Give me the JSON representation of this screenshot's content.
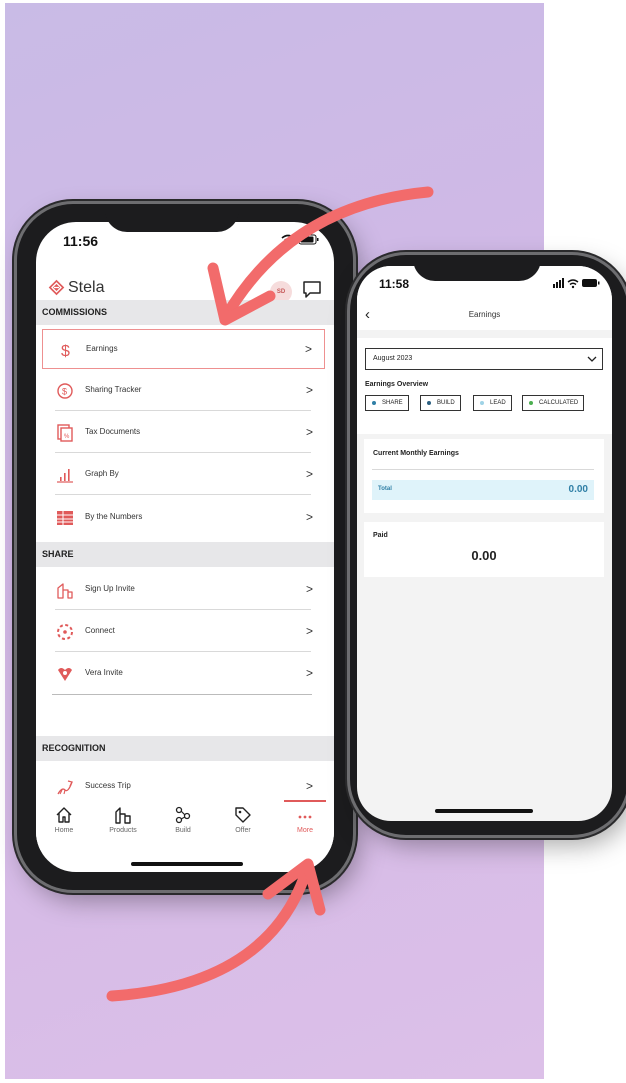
{
  "phone1": {
    "status_time": "11:56",
    "app_name": "Stela",
    "avatar_initials": "SD",
    "sections": {
      "commissions": {
        "title": "COMMISSIONS",
        "items": [
          {
            "label": "Earnings",
            "icon": "dollar-icon",
            "selected": true
          },
          {
            "label": "Sharing Tracker",
            "icon": "sharing-tracker-icon"
          },
          {
            "label": "Tax Documents",
            "icon": "tax-document-icon"
          },
          {
            "label": "Graph By",
            "icon": "bar-graph-icon"
          },
          {
            "label": "By the Numbers",
            "icon": "table-icon"
          }
        ]
      },
      "share": {
        "title": "SHARE",
        "items": [
          {
            "label": "Sign Up Invite",
            "icon": "sign-up-invite-icon"
          },
          {
            "label": "Connect",
            "icon": "connect-icon"
          },
          {
            "label": "Vera Invite",
            "icon": "vera-invite-icon"
          }
        ]
      },
      "recognition": {
        "title": "RECOGNITION",
        "items": [
          {
            "label": "Success Trip",
            "icon": "success-trip-icon"
          }
        ]
      }
    },
    "chevron": ">",
    "tabs": [
      {
        "label": "Home",
        "icon": "home-icon"
      },
      {
        "label": "Products",
        "icon": "products-icon"
      },
      {
        "label": "Build",
        "icon": "build-icon"
      },
      {
        "label": "Offer",
        "icon": "tag-icon"
      },
      {
        "label": "More",
        "icon": "more-icon",
        "active": true
      }
    ]
  },
  "phone2": {
    "status_time": "11:58",
    "title": "Earnings",
    "month_select": "August 2023",
    "overview_title": "Earnings Overview",
    "legend": [
      {
        "label": "SHARE",
        "color": "#2f7fa6"
      },
      {
        "label": "BUILD",
        "color": "#2b5f80"
      },
      {
        "label": "LEAD",
        "color": "#9fd3e6"
      },
      {
        "label": "CALCULATED",
        "color": "#4caf50"
      }
    ],
    "current_monthly_title": "Current Monthly Earnings",
    "total_label": "Total",
    "total_value": "0.00",
    "paid_title": "Paid",
    "paid_value": "0.00"
  },
  "colors": {
    "accent": "#e05a5a",
    "arrow": "#f26b6b",
    "background_gradient_start": "#c9bbe6",
    "background_gradient_end": "#dcc0e8"
  }
}
